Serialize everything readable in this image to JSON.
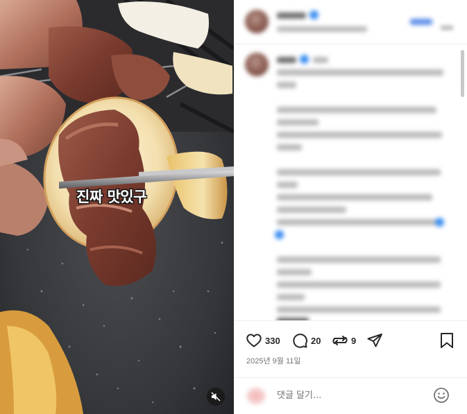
{
  "video": {
    "caption": "진짜 맛있구",
    "mute_icon": "speaker-muted-icon"
  },
  "post": {
    "date": "2025년 9월 11일"
  },
  "actions": {
    "like": {
      "icon": "heart-icon",
      "count": "330"
    },
    "comment": {
      "icon": "comment-bubble-icon",
      "count": "20"
    },
    "repost": {
      "icon": "repost-icon",
      "count": "9"
    },
    "share": {
      "icon": "paper-plane-icon"
    },
    "save": {
      "icon": "bookmark-icon"
    }
  },
  "comment_box": {
    "placeholder": "댓글 달기...",
    "emoji_icon": "smiley-icon"
  },
  "colors": {
    "text": "#262626",
    "muted": "#737373",
    "divider": "#efefef",
    "verified": "#3c8ff0"
  }
}
